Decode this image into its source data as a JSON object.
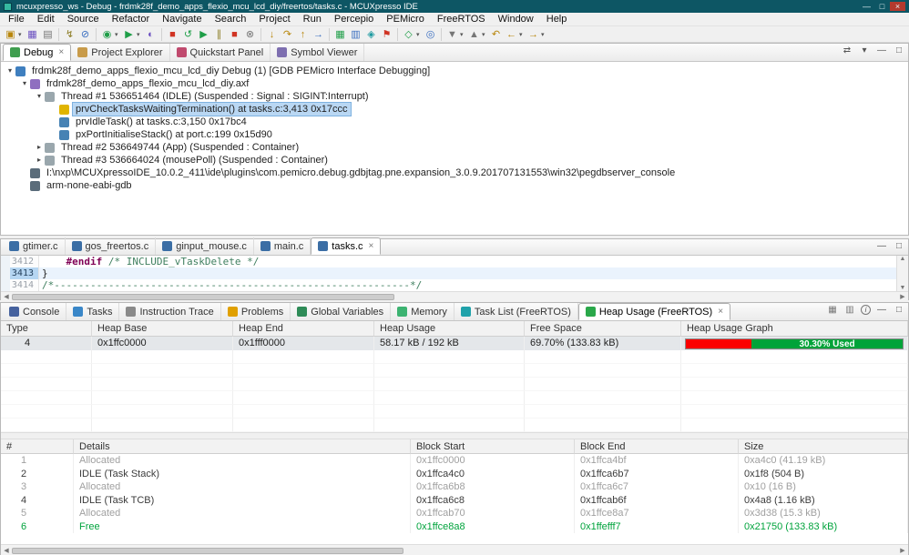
{
  "window": {
    "title": "mcuxpresso_ws - Debug - frdmk28f_demo_apps_flexio_mcu_lcd_diy/freertos/tasks.c - MCUXpresso IDE",
    "controls": {
      "minimize": "—",
      "maximize": "□",
      "close": "×"
    }
  },
  "icons": {
    "close": "×",
    "minimize": "—",
    "maximize": "□",
    "dropdown": "▾",
    "scroll_up": "▲",
    "scroll_down": "▼",
    "scroll_left": "◀",
    "scroll_right": "▶",
    "link": "⇄",
    "view_menu": "▾",
    "info": "i",
    "collapse_all": "⊟"
  },
  "colors": {
    "titlebar": "#0d5664",
    "selection": "#b9d7f3",
    "graph_red": "#fb0000",
    "graph_green": "#00a339",
    "free_row_text": "#00a33c"
  },
  "menu": {
    "items": [
      "File",
      "Edit",
      "Source",
      "Refactor",
      "Navigate",
      "Search",
      "Project",
      "Run",
      "Percepio",
      "PEMicro",
      "FreeRTOS",
      "Window",
      "Help"
    ]
  },
  "toolbar": {
    "icons": [
      {
        "name": "new-wizard-icon",
        "glyph": "▣"
      },
      {
        "name": "save-icon",
        "glyph": "▦"
      },
      {
        "name": "print-icon",
        "glyph": "▤"
      },
      {
        "name": "build-icon",
        "glyph": "↯"
      },
      {
        "name": "skip-breakpoints-icon",
        "glyph": "⊘"
      },
      {
        "name": "debug-icon",
        "glyph": "◉"
      },
      {
        "name": "run-icon",
        "glyph": "▶"
      },
      {
        "name": "profile-icon",
        "glyph": "◐"
      },
      {
        "name": "terminate-icon",
        "glyph": "■"
      },
      {
        "name": "restart-icon",
        "glyph": "↺"
      },
      {
        "name": "resume-icon",
        "glyph": "▶"
      },
      {
        "name": "suspend-icon",
        "glyph": "∥"
      },
      {
        "name": "stop-icon",
        "glyph": "■"
      },
      {
        "name": "disconnect-icon",
        "glyph": "⊗"
      },
      {
        "name": "step-into-icon",
        "glyph": "↓"
      },
      {
        "name": "step-over-icon",
        "glyph": "↷"
      },
      {
        "name": "step-return-icon",
        "glyph": "↑"
      },
      {
        "name": "instruction-stepping-icon",
        "glyph": "→"
      },
      {
        "name": "memory-icon",
        "glyph": "▦"
      },
      {
        "name": "registers-icon",
        "glyph": "▥"
      },
      {
        "name": "peripherals-icon",
        "glyph": "◈"
      },
      {
        "name": "fault-icon",
        "glyph": "⚑"
      },
      {
        "name": "external-tools-icon",
        "glyph": "◇"
      },
      {
        "name": "search-icon",
        "glyph": "◎"
      },
      {
        "name": "next-annotation-icon",
        "glyph": "▼"
      },
      {
        "name": "previous-annotation-icon",
        "glyph": "▲"
      },
      {
        "name": "last-edit-location-icon",
        "glyph": "↶"
      },
      {
        "name": "back-icon",
        "glyph": "←"
      },
      {
        "name": "forward-icon",
        "glyph": "→"
      }
    ]
  },
  "debug_view": {
    "tabs": [
      {
        "label": "Debug",
        "active": true
      },
      {
        "label": "Project Explorer"
      },
      {
        "label": "Quickstart Panel"
      },
      {
        "label": "Symbol Viewer"
      }
    ],
    "tree": [
      {
        "expander": "▾",
        "label": "frdmk28f_demo_apps_flexio_mcu_lcd_diy Debug (1) [GDB PEMicro Interface Debugging]"
      },
      {
        "expander": "▾",
        "label": "frdmk28f_demo_apps_flexio_mcu_lcd_diy.axf"
      },
      {
        "expander": "▾",
        "label": "Thread #1 536651464 (IDLE) (Suspended : Signal : SIGINT:Interrupt)"
      },
      {
        "expander": "",
        "label": "prvCheckTasksWaitingTermination() at tasks.c:3,413 0x17ccc",
        "selected": true
      },
      {
        "expander": "",
        "label": "prvIdleTask() at tasks.c:3,150 0x17bc4"
      },
      {
        "expander": "",
        "label": "pxPortInitialiseStack() at port.c:199 0x15d90"
      },
      {
        "expander": "▸",
        "label": "Thread #2 536649744 (App) (Suspended : Container)"
      },
      {
        "expander": "▸",
        "label": "Thread #3 536664024 (mousePoll) (Suspended : Container)"
      },
      {
        "expander": "",
        "label": "I:\\nxp\\MCUXpressoIDE_10.0.2_411\\ide\\plugins\\com.pemicro.debug.gdbjtag.pne.expansion_3.0.9.201707131553\\win32\\pegdbserver_console"
      },
      {
        "expander": "",
        "label": "arm-none-eabi-gdb"
      }
    ]
  },
  "editor": {
    "tabs": [
      {
        "label": "gtimer.c"
      },
      {
        "label": "gos_freertos.c"
      },
      {
        "label": "ginput_mouse.c"
      },
      {
        "label": "main.c"
      },
      {
        "label": "tasks.c",
        "active": true
      }
    ],
    "lines": [
      {
        "num": "3412",
        "directive": "    #endif",
        "comment": " /* INCLUDE_vTaskDelete */"
      },
      {
        "num": "3413",
        "code": "}"
      },
      {
        "num": "3414",
        "comment": "/*-----------------------------------------------------------*/"
      }
    ]
  },
  "bottom_view": {
    "tabs": [
      {
        "label": "Console"
      },
      {
        "label": "Tasks"
      },
      {
        "label": "Instruction Trace"
      },
      {
        "label": "Problems"
      },
      {
        "label": "Global Variables"
      },
      {
        "label": "Memory"
      },
      {
        "label": "Task List (FreeRTOS)"
      },
      {
        "label": "Heap Usage (FreeRTOS)",
        "active": true
      }
    ],
    "heap_table": {
      "columns": [
        "Type",
        "Heap Base",
        "Heap End",
        "Heap Usage",
        "Free Space",
        "Heap Usage Graph"
      ],
      "rows": [
        {
          "type": "4",
          "heap_base": "0x1ffc0000",
          "heap_end": "0x1fff0000",
          "heap_usage": "58.17 kB / 192 kB",
          "free_space": "69.70% (133.83 kB)",
          "graph": {
            "used_pct": "30.30",
            "label": "30.30% Used",
            "red_style": "width:30.3%;background:#fb0000",
            "green_style": "background:#00a339"
          }
        }
      ]
    },
    "block_table": {
      "columns": [
        "#",
        "Details",
        "Block Start",
        "Block End",
        "Size"
      ],
      "rows": [
        {
          "num": "1",
          "details": "Allocated",
          "start": "0x1ffc0000",
          "end": "0x1ffca4bf",
          "size": "0xa4c0 (41.19 kB)",
          "kind": "allocated"
        },
        {
          "num": "2",
          "details": "IDLE (Task Stack)",
          "start": "0x1ffca4c0",
          "end": "0x1ffca6b7",
          "size": "0x1f8 (504 B)",
          "kind": "task"
        },
        {
          "num": "3",
          "details": "Allocated",
          "start": "0x1ffca6b8",
          "end": "0x1ffca6c7",
          "size": "0x10 (16 B)",
          "kind": "allocated"
        },
        {
          "num": "4",
          "details": "IDLE (Task TCB)",
          "start": "0x1ffca6c8",
          "end": "0x1ffcab6f",
          "size": "0x4a8 (1.16 kB)",
          "kind": "task"
        },
        {
          "num": "5",
          "details": "Allocated",
          "start": "0x1ffcab70",
          "end": "0x1ffce8a7",
          "size": "0x3d38 (15.3 kB)",
          "kind": "allocated"
        },
        {
          "num": "6",
          "details": "Free",
          "start": "0x1ffce8a8",
          "end": "0x1ffefff7",
          "size": "0x21750 (133.83 kB)",
          "kind": "free"
        }
      ]
    }
  }
}
